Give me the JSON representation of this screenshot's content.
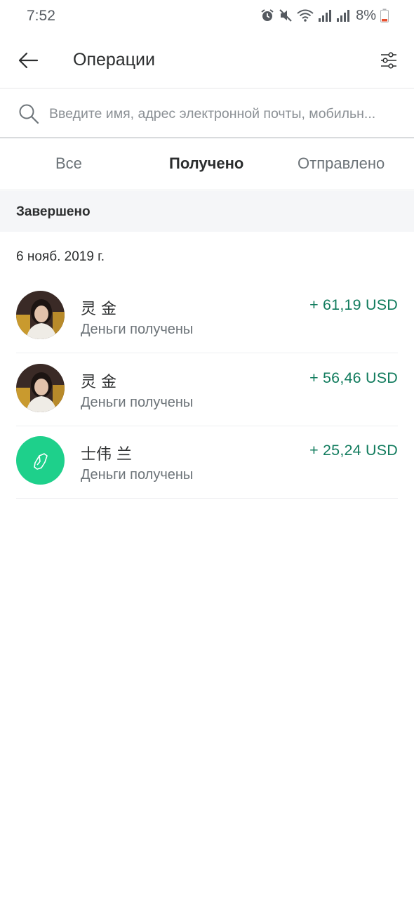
{
  "status_bar": {
    "time": "7:52",
    "battery": "8%",
    "icons": [
      "alarm-icon",
      "mute-icon",
      "wifi-icon",
      "signal-icon",
      "signal-icon",
      "battery-low-icon"
    ],
    "battery_color": "#e8502f"
  },
  "header": {
    "title": "Операции",
    "back_icon": "arrow-left-icon",
    "filter_icon": "sliders-icon"
  },
  "search": {
    "placeholder": "Введите имя, адрес электронной почты, мобильн..."
  },
  "tabs": [
    {
      "label": "Все",
      "active": false
    },
    {
      "label": "Получено",
      "active": true
    },
    {
      "label": "Отправлено",
      "active": false
    }
  ],
  "section": {
    "title": "Завершено",
    "date": "6 нояб. 2019 г."
  },
  "transactions": [
    {
      "name": "灵 金",
      "status": "Деньги получены",
      "amount": "+ 61,19 USD",
      "avatar": "photo"
    },
    {
      "name": "灵 金",
      "status": "Деньги получены",
      "amount": "+ 56,46 USD",
      "avatar": "photo"
    },
    {
      "name": "士伟 兰",
      "status": "Деньги получены",
      "amount": "+ 25,24 USD",
      "avatar": "brand-icon"
    }
  ],
  "colors": {
    "amount_positive": "#127c5e",
    "avatar_green": "#1ed08b",
    "section_bg": "#f5f6f8"
  }
}
